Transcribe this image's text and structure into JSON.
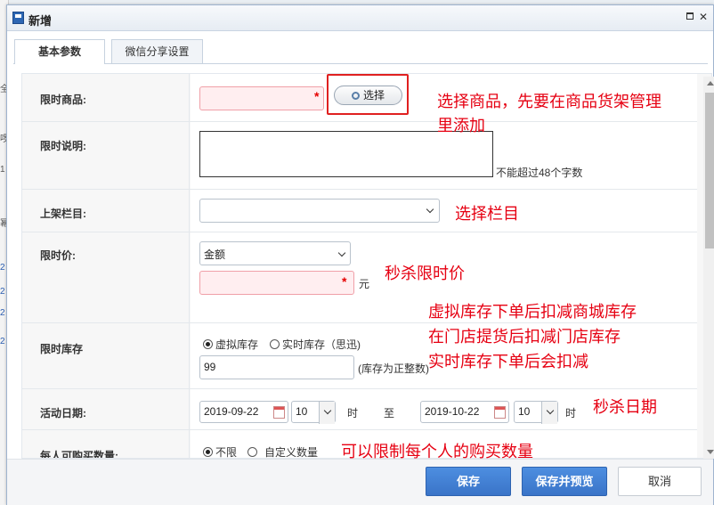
{
  "dialog": {
    "title": "新增"
  },
  "tabs": [
    {
      "label": "基本参数"
    },
    {
      "label": "微信分享设置"
    }
  ],
  "background": {
    "glyphs": [
      "全",
      "啰",
      "1",
      "幂",
      "2",
      "2",
      "2",
      "2"
    ]
  },
  "form": {
    "product": {
      "label": "限时商品:",
      "value": "",
      "select_button": "选择"
    },
    "description": {
      "label": "限时说明:",
      "value": "",
      "hint": "不能超过48个字数"
    },
    "column": {
      "label": "上架栏目:",
      "value": ""
    },
    "price": {
      "label": "限时价:",
      "type_value": "金额",
      "value": "",
      "unit": "元"
    },
    "stock": {
      "label": "限时库存",
      "options": [
        {
          "label": "虚拟库存",
          "checked": true
        },
        {
          "label": "实时库存（思迅)",
          "checked": false
        }
      ],
      "value": "99",
      "hint": "(库存为正整数)"
    },
    "dates": {
      "label": "活动日期:",
      "start_date": "2019-09-22",
      "start_hour": "10",
      "hour_unit": "时",
      "to": "至",
      "end_date": "2019-10-22",
      "end_hour": "10",
      "end_hour_unit": "时"
    },
    "limit": {
      "label": "每人可购买数量:",
      "options": [
        {
          "label": "不限",
          "checked": true
        },
        {
          "label": "自定义数量",
          "checked": false
        }
      ]
    }
  },
  "annotations": {
    "select_product": "选择商品，先要在商品货架管理",
    "select_product_2": "里添加",
    "select_column": "选择栏目",
    "flash_price": "秒杀限时价",
    "stock_1": "虚拟库存下单后扣减商城库存",
    "stock_2": "在门店提货后扣减门店库存",
    "stock_3": "实时库存下单后会扣减",
    "flash_date": "秒杀日期",
    "limit_note": "可以限制每个人的购买数量"
  },
  "footer": {
    "save": "保存",
    "save_preview": "保存并预览",
    "cancel": "取消"
  },
  "colors": {
    "annotation": "#e60012",
    "primary_button": "#3a74c8",
    "required_bg": "#ffeef0"
  }
}
